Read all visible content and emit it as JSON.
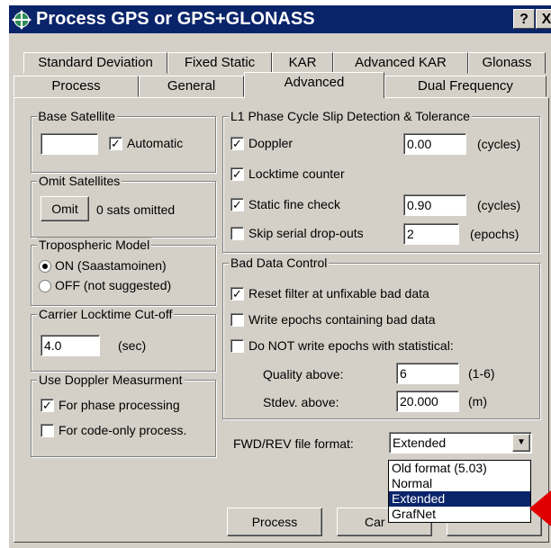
{
  "window": {
    "title": "Process GPS or GPS+GLONASS",
    "help_label": "?",
    "close_label": "X"
  },
  "tabs_back": [
    "Standard Deviation",
    "Fixed Static",
    "KAR",
    "Advanced KAR",
    "Glonass"
  ],
  "tabs_front": [
    "Process",
    "General",
    "Advanced",
    "Dual Frequency"
  ],
  "active_tab": "Advanced",
  "base_satellite": {
    "title": "Base Satellite",
    "value": "",
    "automatic_label": "Automatic",
    "automatic_checked": true
  },
  "omit_satellites": {
    "title": "Omit Satellites",
    "button_label": "Omit",
    "status": "0 sats omitted"
  },
  "tropospheric": {
    "title": "Tropospheric Model",
    "options": [
      "ON (Saastamoinen)",
      "OFF (not suggested)"
    ],
    "selected": 0
  },
  "carrier_locktime": {
    "title": "Carrier Locktime Cut-off",
    "value": "4.0",
    "unit": "(sec)"
  },
  "doppler_measurement": {
    "title": "Use Doppler Measurment",
    "phase_label": "For phase processing",
    "phase_checked": true,
    "code_label": "For code-only process.",
    "code_checked": false
  },
  "cycle_slip": {
    "title": "L1 Phase Cycle Slip Detection & Tolerance",
    "doppler": {
      "label": "Doppler",
      "checked": true,
      "value": "0.00",
      "unit": "(cycles)"
    },
    "locktime_counter": {
      "label": "Locktime counter",
      "checked": true
    },
    "static_fine_check": {
      "label": "Static fine check",
      "checked": true,
      "value": "0.90",
      "unit": "(cycles)"
    },
    "skip_serial": {
      "label": "Skip serial drop-outs",
      "checked": false,
      "value": "2",
      "unit": "(epochs)"
    }
  },
  "bad_data": {
    "title": "Bad Data Control",
    "reset_filter": {
      "label": "Reset filter at unfixable bad data",
      "checked": true
    },
    "write_epochs": {
      "label": "Write epochs containing bad data",
      "checked": false
    },
    "do_not_write": {
      "label": "Do NOT write epochs with statistical:",
      "checked": false
    },
    "quality": {
      "label": "Quality above:",
      "value": "6",
      "unit": "(1-6)"
    },
    "stdev": {
      "label": "Stdev. above:",
      "value": "20.000",
      "unit": "(m)"
    }
  },
  "file_format": {
    "label": "FWD/REV file format:",
    "selected": "Extended",
    "options": [
      "Old format (5.03)",
      "Normal",
      "Extended",
      "GrafNet"
    ]
  },
  "buttons": {
    "process": "Process",
    "cancel": "Car"
  },
  "colors": {
    "titlebar": "#0a246a",
    "face": "#d4d0c8",
    "selection": "#0a246a",
    "arrow": "#e00000"
  }
}
